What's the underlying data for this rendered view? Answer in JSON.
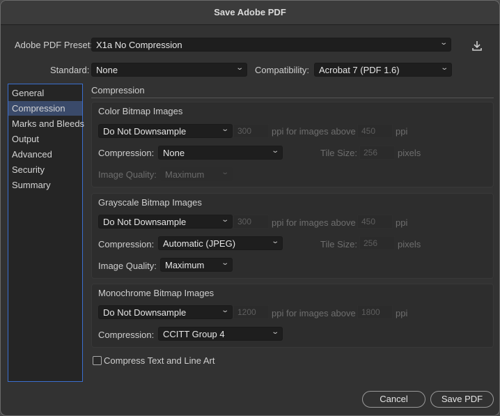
{
  "window": {
    "title": "Save Adobe PDF"
  },
  "header": {
    "preset_label": "Adobe PDF Preset:",
    "preset_value": "X1a No Compression",
    "standard_label": "Standard:",
    "standard_value": "None",
    "compatibility_label": "Compatibility:",
    "compatibility_value": "Acrobat 7 (PDF 1.6)",
    "save_preset_icon": "download-icon"
  },
  "sidebar": {
    "items": [
      {
        "label": "General",
        "selected": false
      },
      {
        "label": "Compression",
        "selected": true
      },
      {
        "label": "Marks and Bleeds",
        "selected": false
      },
      {
        "label": "Output",
        "selected": false
      },
      {
        "label": "Advanced",
        "selected": false
      },
      {
        "label": "Security",
        "selected": false
      },
      {
        "label": "Summary",
        "selected": false
      }
    ]
  },
  "main": {
    "section_title": "Compression",
    "color": {
      "title": "Color Bitmap Images",
      "downsample": "Do Not Downsample",
      "ppi": "300",
      "ppi_above_label": "ppi for images above",
      "above_value": "450",
      "ppi_suffix": "ppi",
      "compression_label": "Compression:",
      "compression": "None",
      "tile_label": "Tile Size:",
      "tile_value": "256",
      "tile_suffix": "pixels",
      "quality_label": "Image Quality:",
      "quality": "Maximum"
    },
    "grayscale": {
      "title": "Grayscale Bitmap Images",
      "downsample": "Do Not Downsample",
      "ppi": "300",
      "ppi_above_label": "ppi for images above",
      "above_value": "450",
      "ppi_suffix": "ppi",
      "compression_label": "Compression:",
      "compression": "Automatic (JPEG)",
      "tile_label": "Tile Size:",
      "tile_value": "256",
      "tile_suffix": "pixels",
      "quality_label": "Image Quality:",
      "quality": "Maximum"
    },
    "mono": {
      "title": "Monochrome Bitmap Images",
      "downsample": "Do Not Downsample",
      "ppi": "1200",
      "ppi_above_label": "ppi for images above",
      "above_value": "1800",
      "ppi_suffix": "ppi",
      "compression_label": "Compression:",
      "compression": "CCITT Group 4"
    },
    "compress_text_label": "Compress Text and Line Art",
    "compress_text_checked": false
  },
  "footer": {
    "cancel": "Cancel",
    "save": "Save PDF"
  },
  "colors": {
    "accent": "#3b6fd0",
    "selection": "#3a4a6a"
  }
}
